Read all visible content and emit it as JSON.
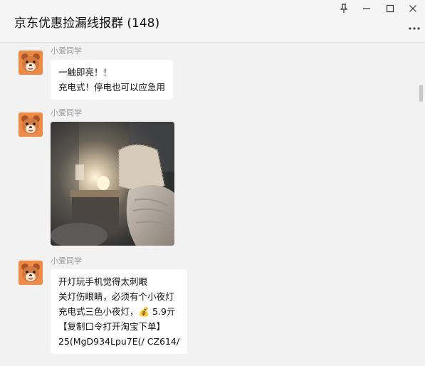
{
  "window": {
    "title": "京东优惠捡漏线报群 (148)",
    "pin_icon": "pin-icon",
    "minimize_icon": "minimize-icon",
    "maximize_icon": "maximize-icon",
    "close_icon": "close-icon",
    "more_icon": "more-icon"
  },
  "messages": [
    {
      "sender": "小爱同学",
      "type": "text",
      "lines": [
        "一触即亮！！",
        "充电式！停电也可以应急用"
      ]
    },
    {
      "sender": "小爱同学",
      "type": "image",
      "image_icon": "bedside-night-lamp-photo"
    },
    {
      "sender": "小爱同学",
      "type": "text",
      "lines": [
        "开灯玩手机觉得太刺眼",
        "关灯伤眼睛，必须有个小夜灯",
        "充电式三色小夜灯，💰 5.9亓",
        "【复制口令打开淘宝下单】",
        "25(MgD934Lpu7E(/ CZ614/"
      ]
    }
  ],
  "colors": {
    "background": "#f2f2f2",
    "bubble": "#ffffff",
    "sender_name": "#999999"
  }
}
